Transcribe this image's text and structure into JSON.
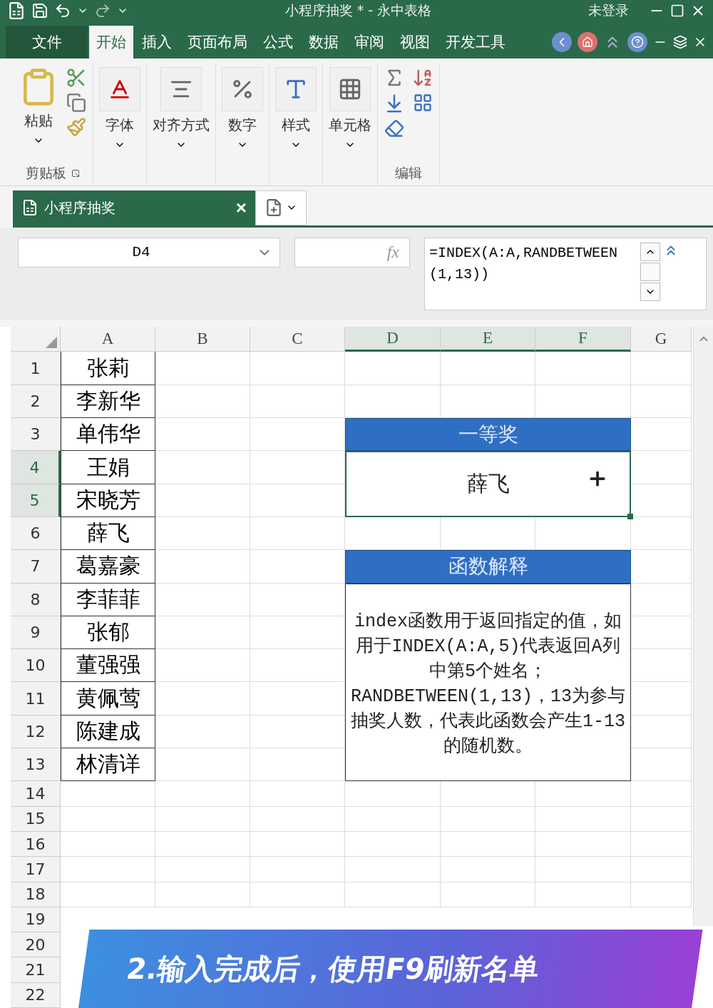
{
  "title_bar": {
    "title": "小程序抽奖 * - 永中表格",
    "account": "未登录"
  },
  "menu_tabs": [
    {
      "label": "文件",
      "selected": false,
      "kind": "file"
    },
    {
      "label": "开始",
      "selected": true,
      "kind": "tab"
    },
    {
      "label": "插入",
      "selected": false,
      "kind": "tab"
    },
    {
      "label": "页面布局",
      "selected": false,
      "kind": "tab"
    },
    {
      "label": "公式",
      "selected": false,
      "kind": "tab"
    },
    {
      "label": "数据",
      "selected": false,
      "kind": "tab"
    },
    {
      "label": "审阅",
      "selected": false,
      "kind": "tab"
    },
    {
      "label": "视图",
      "selected": false,
      "kind": "tab"
    },
    {
      "label": "开发工具",
      "selected": false,
      "kind": "tab"
    }
  ],
  "ribbon": {
    "paste": "粘贴",
    "clipboard_group": "剪贴板",
    "buttons": [
      {
        "label": "字体",
        "kind": "font"
      },
      {
        "label": "对齐方式",
        "kind": "align"
      },
      {
        "label": "数字",
        "kind": "number"
      },
      {
        "label": "样式",
        "kind": "style"
      },
      {
        "label": "单元格",
        "kind": "cell"
      }
    ],
    "edit_group": "编辑"
  },
  "document_tab": {
    "title": "小程序抽奖",
    "close": "×"
  },
  "formula_bar": {
    "name_box": "D4",
    "fx_label": "fx",
    "formula": "=INDEX(A:A,RANDBETWEEN(1,13))"
  },
  "sheet": {
    "columns": [
      {
        "label": "A",
        "selected": false
      },
      {
        "label": "B",
        "selected": false
      },
      {
        "label": "C",
        "selected": false
      },
      {
        "label": "D",
        "selected": true
      },
      {
        "label": "E",
        "selected": true
      },
      {
        "label": "F",
        "selected": true
      },
      {
        "label": "G",
        "selected": false
      }
    ],
    "rows": [
      {
        "label": "1",
        "selected": false,
        "value": "张莉"
      },
      {
        "label": "2",
        "selected": false,
        "value": "李新华"
      },
      {
        "label": "3",
        "selected": false,
        "value": "单伟华"
      },
      {
        "label": "4",
        "selected": true,
        "value": "王娟"
      },
      {
        "label": "5",
        "selected": true,
        "value": "宋晓芳"
      },
      {
        "label": "6",
        "selected": false,
        "value": "薛飞"
      },
      {
        "label": "7",
        "selected": false,
        "value": "葛嘉豪"
      },
      {
        "label": "8",
        "selected": false,
        "value": "李菲菲"
      },
      {
        "label": "9",
        "selected": false,
        "value": "张郁"
      },
      {
        "label": "10",
        "selected": false,
        "value": "董强强"
      },
      {
        "label": "11",
        "selected": false,
        "value": "黄佩莺"
      },
      {
        "label": "12",
        "selected": false,
        "value": "陈建成"
      },
      {
        "label": "13",
        "selected": false,
        "value": "林清详"
      },
      {
        "label": "14",
        "selected": false
      },
      {
        "label": "15",
        "selected": false
      },
      {
        "label": "16",
        "selected": false
      },
      {
        "label": "17",
        "selected": false
      },
      {
        "label": "18",
        "selected": false
      },
      {
        "label": "19",
        "selected": false
      },
      {
        "label": "20",
        "selected": false
      },
      {
        "label": "21",
        "selected": false
      },
      {
        "label": "22",
        "selected": false
      }
    ],
    "merged_blocks": [
      {
        "kind": "header",
        "text": "一等奖",
        "selected": false
      },
      {
        "kind": "result",
        "text": "薛飞",
        "selected": true
      },
      {
        "kind": "header",
        "text": "函数解释",
        "selected": false
      },
      {
        "kind": "note",
        "text": "index函数用于返回指定的值，如用于INDEX(A:A,5)代表返回A列中第5个姓名；RANDBETWEEN(1,13)，13为参与抽奖人数，代表此函数会产生1-13的随机数。",
        "selected": false
      }
    ]
  },
  "caption": "2.输入完成后，使用F9刷新名单"
}
